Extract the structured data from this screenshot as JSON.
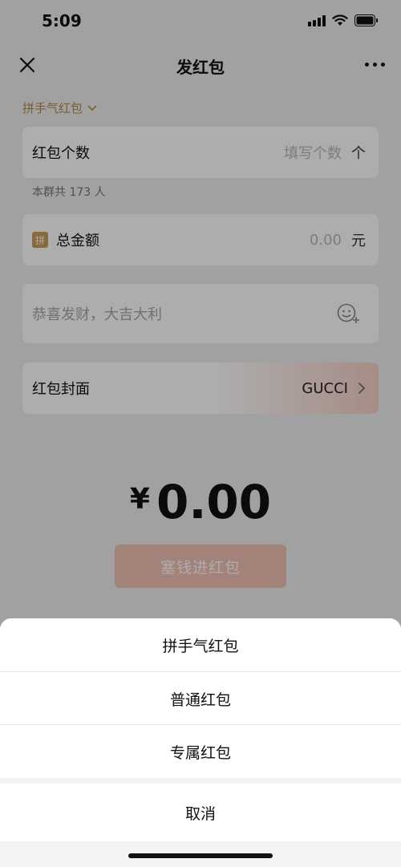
{
  "status_bar": {
    "time": "5:09"
  },
  "nav": {
    "title": "发红包"
  },
  "type_selector": {
    "label": "拼手气红包"
  },
  "count_card": {
    "label": "红包个数",
    "placeholder": "填写个数",
    "unit": "个"
  },
  "group_note": "本群共 173 人",
  "amount_card": {
    "badge": "拼",
    "label": "总金额",
    "placeholder": "0.00",
    "unit": "元"
  },
  "greeting": {
    "placeholder": "恭喜发财，大吉大利"
  },
  "cover_card": {
    "label": "红包封面",
    "value": "GUCCI"
  },
  "amount_display": {
    "currency": "¥",
    "amount": "0.00"
  },
  "submit_button": {
    "label": "塞钱进红包"
  },
  "action_sheet": {
    "options": [
      "拼手气红包",
      "普通红包",
      "专属红包"
    ],
    "cancel": "取消"
  },
  "colors": {
    "accent_gold": "#c79b58",
    "button_red_disabled": "#f1c0b4",
    "background": "#ededed"
  }
}
